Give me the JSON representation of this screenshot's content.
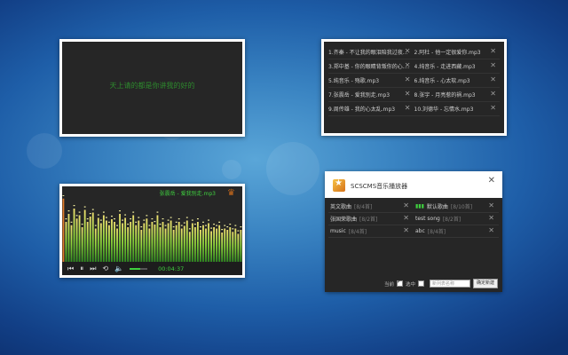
{
  "lyric_panel": {
    "text": "天上请的都是你讲我的好的"
  },
  "playlist_panel": {
    "songs": [
      "1.齐秦 - 不让我的眼泪陪我过夜...",
      "2.阿杜 - 他一定很爱你.mp3",
      "3.郑中基 - 你的眼睛背叛你的心....",
      "4.纯音乐 - 走进西藏.mp3",
      "5.纯音乐 - 殇歌.mp3",
      "6.纯音乐 - 心太软.mp3",
      "7.张震岳 - 爱我别走.mp3",
      "8.张宇 - 月亮惹的祸.mp3",
      "9.周传雄 - 我的心太乱.mp3",
      "10.刘德华 - 忘情水.mp3"
    ]
  },
  "visualizer_panel": {
    "now_playing": "张震岳 - 爱我别走.mp3",
    "time": "00:04:37",
    "volume_level": 0.6,
    "levels": [
      0.95,
      0.6,
      0.72,
      0.55,
      0.8,
      0.65,
      0.7,
      0.52,
      0.78,
      0.6,
      0.68,
      0.74,
      0.5,
      0.66,
      0.58,
      0.7,
      0.62,
      0.55,
      0.64,
      0.6,
      0.5,
      0.72,
      0.58,
      0.66,
      0.52,
      0.6,
      0.7,
      0.55,
      0.62,
      0.48,
      0.58,
      0.65,
      0.5,
      0.6,
      0.56,
      0.7,
      0.52,
      0.6,
      0.5,
      0.58,
      0.62,
      0.48,
      0.55,
      0.6,
      0.5,
      0.54,
      0.62,
      0.45,
      0.58,
      0.52,
      0.6,
      0.48,
      0.55,
      0.5,
      0.58,
      0.46,
      0.52,
      0.5,
      0.55,
      0.44,
      0.5,
      0.48,
      0.52,
      0.45,
      0.5,
      0.42,
      0.48
    ]
  },
  "player_window": {
    "title": "SCSCMS音乐播放器",
    "lists": [
      {
        "name": "英文歌曲",
        "count": "[8/4首]",
        "active": false
      },
      {
        "name": "默认歌曲",
        "count": "[8/10首]",
        "active": true
      },
      {
        "name": "张国荣歌曲",
        "count": "[8/2首]",
        "active": false
      },
      {
        "name": "test song",
        "count": "[8/2首]",
        "active": false
      },
      {
        "name": "music",
        "count": "[8/4首]",
        "active": false
      },
      {
        "name": "abc",
        "count": "[8/4首]",
        "active": false
      }
    ],
    "footer": {
      "label_a": "当前",
      "label_b": "选中",
      "input_placeholder": "新列表名称",
      "button_label": "确定新建"
    }
  },
  "colors": {
    "accent_green": "#3fcf3f",
    "panel_dark": "#262626"
  }
}
